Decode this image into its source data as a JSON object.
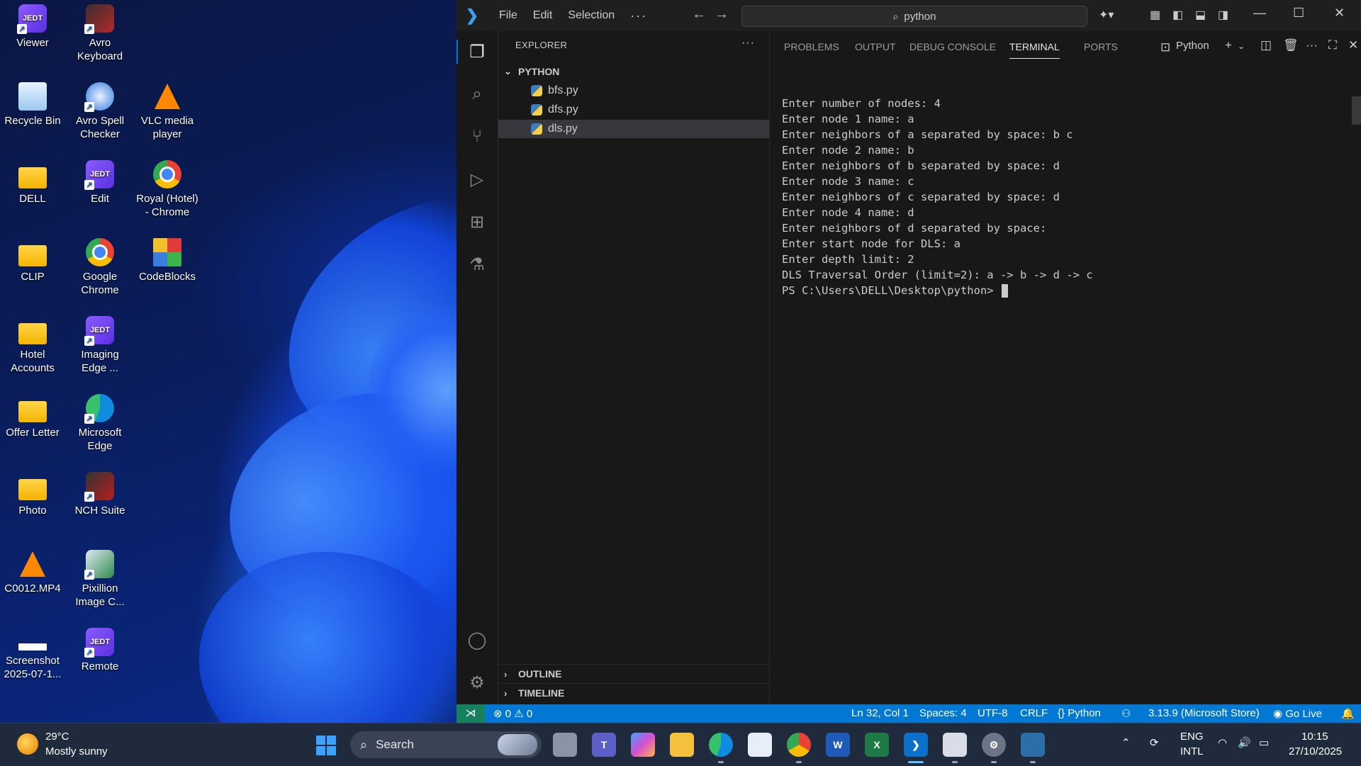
{
  "desktop": {
    "icons": [
      {
        "label": "Viewer"
      },
      {
        "label": "Avro Keyboard"
      },
      {
        "label": "Recycle Bin"
      },
      {
        "label": "Avro Spell Checker"
      },
      {
        "label": "VLC media player"
      },
      {
        "label": "DELL"
      },
      {
        "label": "Edit"
      },
      {
        "label": "Royal (Hotel) - Chrome"
      },
      {
        "label": "CLIP"
      },
      {
        "label": "Google Chrome"
      },
      {
        "label": "CodeBlocks"
      },
      {
        "label": "Hotel Accounts"
      },
      {
        "label": "Imaging Edge ..."
      },
      {
        "label": "Offer Letter"
      },
      {
        "label": "Microsoft Edge"
      },
      {
        "label": "Photo"
      },
      {
        "label": "NCH Suite"
      },
      {
        "label": "C0012.MP4"
      },
      {
        "label": "Pixillion Image C..."
      },
      {
        "label": "Screenshot 2025-07-1..."
      },
      {
        "label": "Remote"
      }
    ],
    "jedt_badge": "JEDT"
  },
  "vscode": {
    "menu": {
      "file": "File",
      "edit": "Edit",
      "selection": "Selection",
      "more": "···"
    },
    "search": {
      "text": "python"
    },
    "explorer": {
      "header": "EXPLORER",
      "more": "···",
      "folder": "PYTHON",
      "files": [
        {
          "name": "bfs.py"
        },
        {
          "name": "dfs.py"
        },
        {
          "name": "dls.py"
        }
      ],
      "sections": {
        "outline": "OUTLINE",
        "timeline": "TIMELINE"
      }
    },
    "panel": {
      "tabs": {
        "problems": "PROBLEMS",
        "output": "OUTPUT",
        "debug": "DEBUG CONSOLE",
        "terminal": "TERMINAL",
        "ports": "PORTS"
      },
      "terminal_profile": "Python",
      "lines": [
        "Enter number of nodes: 4",
        "Enter node 1 name: a",
        "Enter neighbors of a separated by space: b c",
        "Enter node 2 name: b",
        "Enter neighbors of b separated by space: d",
        "Enter node 3 name: c",
        "Enter neighbors of c separated by space: d",
        "Enter node 4 name: d",
        "Enter neighbors of d separated by space:",
        "Enter start node for DLS: a",
        "Enter depth limit: 2",
        "DLS Traversal Order (limit=2): a -> b -> d -> c"
      ],
      "prompt": "PS C:\\Users\\DELL\\Desktop\\python> "
    },
    "status": {
      "errors": "0",
      "warnings": "0",
      "position": "Ln 32, Col 1",
      "spaces": "Spaces: 4",
      "encoding": "UTF-8",
      "eol": "CRLF",
      "language": "Python",
      "interpreter": "3.13.9 (Microsoft Store)",
      "golive": "Go Live"
    }
  },
  "taskbar": {
    "weather_temp": "29°C",
    "weather_desc": "Mostly sunny",
    "search_label": "Search",
    "lang_top": "ENG",
    "lang_bottom": "INTL",
    "time": "10:15",
    "date": "27/10/2025"
  },
  "colors": {
    "accent": "#0078d4",
    "remote": "#16825d",
    "taskbar": "#1f2a3c"
  }
}
